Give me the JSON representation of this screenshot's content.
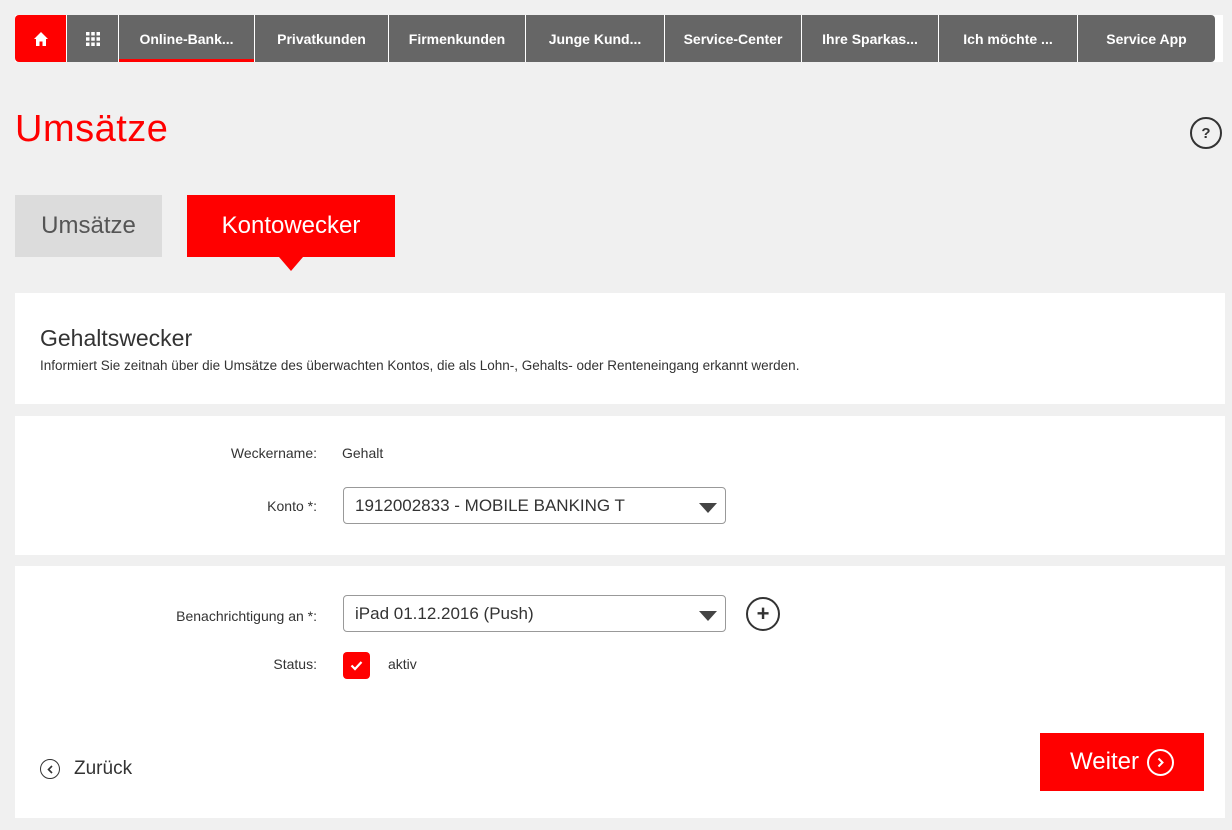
{
  "nav": {
    "items": [
      {
        "label": "Online-Bank..."
      },
      {
        "label": "Privatkunden"
      },
      {
        "label": "Firmenkunden"
      },
      {
        "label": "Junge Kund..."
      },
      {
        "label": "Service-Center"
      },
      {
        "label": "Ihre Sparkas..."
      },
      {
        "label": "Ich möchte ..."
      },
      {
        "label": "Service App"
      }
    ],
    "home_icon": "home-icon",
    "grid_icon": "grid-icon"
  },
  "page": {
    "title": "Umsätze",
    "help_icon_glyph": "?"
  },
  "tabs": [
    {
      "label": "Umsätze",
      "active": false
    },
    {
      "label": "Kontowecker",
      "active": true
    }
  ],
  "info": {
    "title": "Gehaltswecker",
    "description": "Informiert Sie zeitnah über die Umsätze des überwachten Kontos, die als Lohn-, Gehalts- oder Renteneingang erkannt werden."
  },
  "form": {
    "weckername_label": "Weckername:",
    "weckername_value": "Gehalt",
    "konto_label": "Konto *:",
    "konto_value": "1912002833 - MOBILE BANKING T",
    "benachrichtigung_label": "Benachrichtigung an *:",
    "benachrichtigung_value": "iPad 01.12.2016 (Push)",
    "status_label": "Status:",
    "status_value": "aktiv",
    "status_checked": true
  },
  "actions": {
    "back_label": "Zurück",
    "next_label": "Weiter"
  },
  "colors": {
    "brand": "#ff0000",
    "nav_bg": "#666666",
    "page_bg": "#f0f0f0"
  }
}
